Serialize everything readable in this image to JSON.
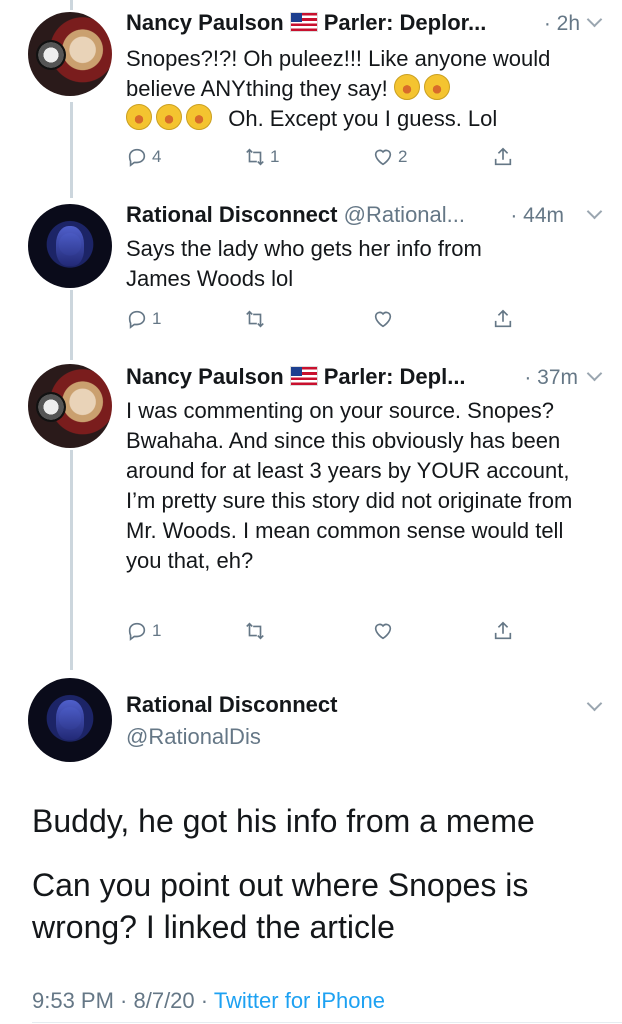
{
  "tweets": [
    {
      "name": "Nancy Paulson",
      "handle": "Parler: Deplor...",
      "time": "· 2h",
      "text": "Snopes?!?! Oh puleez!!! Like anyone would believe ANYthing they say!",
      "text_tail": "Oh.  Except you I guess.  Lol",
      "replies": "4",
      "retweets": "1",
      "likes": "2"
    },
    {
      "name": "Rational Disconnect",
      "handle": "@Rational...",
      "time": "· 44m",
      "text": "Says the lady who gets her info from James Woods lol",
      "replies": "1",
      "retweets": "",
      "likes": ""
    },
    {
      "name": "Nancy Paulson",
      "handle": "Parler: Depl...",
      "time": "· 37m",
      "text": "I was commenting on your source. Snopes? Bwahaha. And since this obviously has been around for at least 3 years by YOUR account, I’m pretty sure this story did not originate from Mr. Woods. I mean common sense would tell you that, eh?",
      "replies": "1",
      "retweets": "",
      "likes": ""
    }
  ],
  "main_tweet": {
    "name": "Rational Disconnect",
    "handle": "@RationalDis",
    "paragraphs": [
      "Buddy, he got his info from a meme",
      "Can you point out where Snopes is wrong? I linked the article"
    ],
    "time": "9:53 PM · 8/7/20 · ",
    "source": "Twitter for iPhone"
  },
  "emoji": {
    "laughing": "rolling-on-the-floor-laughing"
  },
  "colors": {
    "link": "#1da1f2",
    "muted": "#657786",
    "thread": "#ccd6dd"
  }
}
